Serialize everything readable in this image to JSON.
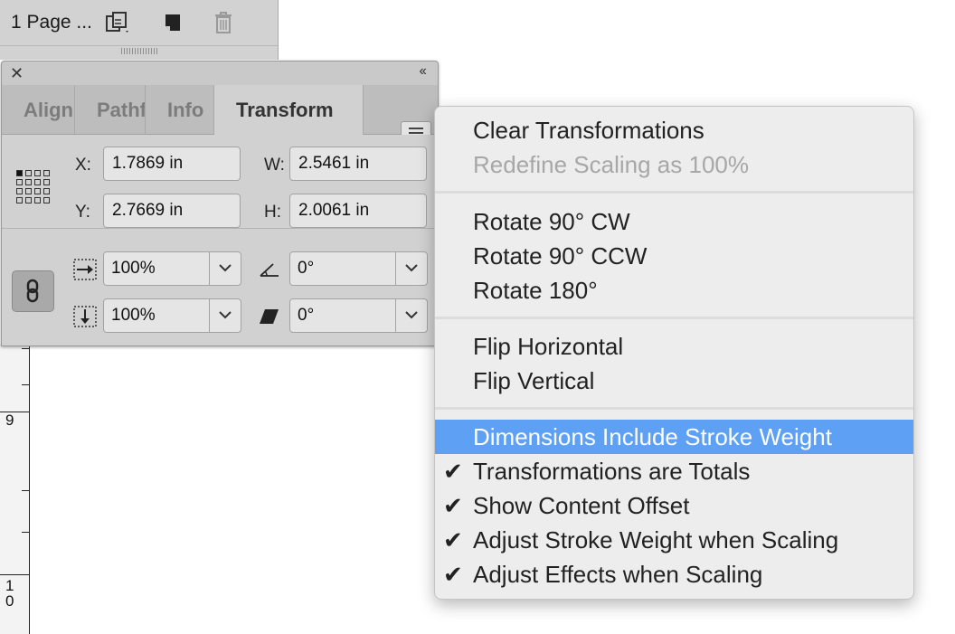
{
  "pages_panel": {
    "label": "1 Page ...",
    "icons": [
      "page-size-icon",
      "new-page-icon",
      "delete-page-icon"
    ]
  },
  "ruler": {
    "labels": [
      "9",
      "1\n0"
    ]
  },
  "panel": {
    "tabs": [
      {
        "label": "Align",
        "active": false
      },
      {
        "label": "Pathfinder",
        "active": false
      },
      {
        "label": "Info",
        "active": false
      },
      {
        "label": "Transform",
        "active": true
      }
    ],
    "fields": {
      "x": {
        "label": "X:",
        "value": "1.7869 in"
      },
      "y": {
        "label": "Y:",
        "value": "2.7669 in"
      },
      "w": {
        "label": "W:",
        "value": "2.5461 in"
      },
      "h": {
        "label": "H:",
        "value": "2.0061 in"
      },
      "scale_x": "100%",
      "scale_y": "100%",
      "rotation": "0°",
      "shear": "0°"
    }
  },
  "context_menu": {
    "items": [
      {
        "label": "Clear Transformations",
        "enabled": true,
        "checked": false,
        "highlighted": false
      },
      {
        "label": "Redefine Scaling as 100%",
        "enabled": false,
        "checked": false,
        "highlighted": false
      },
      {
        "label": "Rotate 90° CW",
        "enabled": true,
        "checked": false,
        "highlighted": false
      },
      {
        "label": "Rotate 90° CCW",
        "enabled": true,
        "checked": false,
        "highlighted": false
      },
      {
        "label": "Rotate 180°",
        "enabled": true,
        "checked": false,
        "highlighted": false
      },
      {
        "label": "Flip Horizontal",
        "enabled": true,
        "checked": false,
        "highlighted": false
      },
      {
        "label": "Flip Vertical",
        "enabled": true,
        "checked": false,
        "highlighted": false
      },
      {
        "label": "Dimensions Include Stroke Weight",
        "enabled": true,
        "checked": false,
        "highlighted": true
      },
      {
        "label": "Transformations are Totals",
        "enabled": true,
        "checked": true,
        "highlighted": false
      },
      {
        "label": "Show Content Offset",
        "enabled": true,
        "checked": true,
        "highlighted": false
      },
      {
        "label": "Adjust Stroke Weight when Scaling",
        "enabled": true,
        "checked": true,
        "highlighted": false
      },
      {
        "label": "Adjust Effects when Scaling",
        "enabled": true,
        "checked": true,
        "highlighted": false
      }
    ],
    "check_glyph": "✔"
  },
  "colors": {
    "highlight": "#5da0f4",
    "disabled_text": "#a7a7a7",
    "panel_bg": "#d1d1d1"
  }
}
